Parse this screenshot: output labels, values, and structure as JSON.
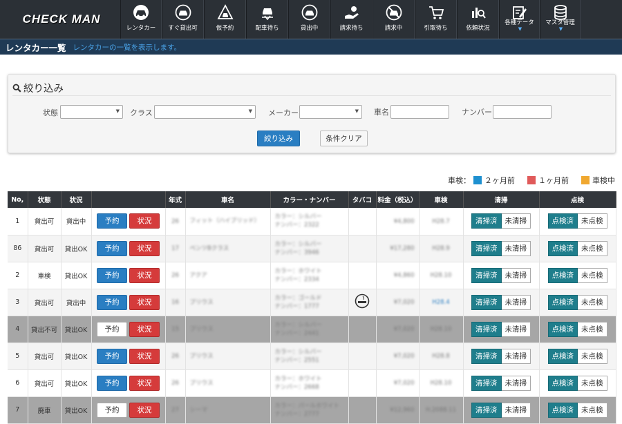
{
  "app": {
    "logo": "CHECK MAN"
  },
  "nav": [
    {
      "label": "レンタカー",
      "icon": "car-icon"
    },
    {
      "label": "すぐ貸出可",
      "icon": "car-circle-icon"
    },
    {
      "label": "仮予約",
      "icon": "warning-car-icon"
    },
    {
      "label": "配車待ち",
      "icon": "dispatch-car-icon"
    },
    {
      "label": "貸出中",
      "icon": "car-circle-icon"
    },
    {
      "label": "請求待ち",
      "icon": "hand-coin-icon"
    },
    {
      "label": "請求中",
      "icon": "no-car-icon"
    },
    {
      "label": "引取待ち",
      "icon": "tow-cart-icon"
    },
    {
      "label": "依頼状況",
      "icon": "chart-search-icon"
    },
    {
      "label": "各種データ",
      "icon": "edit-note-icon",
      "dropdown": true
    },
    {
      "label": "マスタ管理",
      "icon": "database-icon",
      "dropdown": true
    }
  ],
  "page": {
    "title": "レンタカー一覧",
    "description": "レンタカーの一覧を表示します。"
  },
  "filter": {
    "title": "絞り込み",
    "labels": {
      "status": "状態",
      "class": "クラス",
      "maker": "メーカー",
      "car_name": "車名",
      "number": "ナンバー"
    },
    "submit": "絞り込み",
    "clear": "条件クリア"
  },
  "legend": {
    "title": "車検：",
    "items": [
      {
        "label": "２ヶ月前",
        "color": "#1e90d0"
      },
      {
        "label": "１ヶ月前",
        "color": "#e05a5a"
      },
      {
        "label": "車検中",
        "color": "#f0a830"
      }
    ]
  },
  "table": {
    "headers": [
      "No,",
      "状態",
      "状況",
      "",
      "年式",
      "車名",
      "カラー・ナンバー",
      "タバコ",
      "料金（税込）",
      "車検",
      "清掃",
      "点検"
    ],
    "buttons": {
      "reserve": "予約",
      "status": "状況",
      "cleaned": "清掃済",
      "not_cleaned": "未清掃",
      "inspected": "点検済",
      "not_inspected": "未点検"
    },
    "rows": [
      {
        "no": "1",
        "state": "貸出可",
        "situation": "貸出中",
        "year": "26",
        "name": "フィット（ハイブリッド）",
        "color": "カラー：シルバー",
        "plate": "ナンバー：2322",
        "tobacco": false,
        "price": "¥4,800",
        "inspection": "H28.7",
        "dark": false,
        "reserve_active": true
      },
      {
        "no": "86",
        "state": "貸出可",
        "situation": "貸出OK",
        "year": "17",
        "name": "ベンツBクラス",
        "color": "カラー：シルバー",
        "plate": "ナンバー：3946",
        "tobacco": false,
        "price": "¥17,280",
        "inspection": "H28.9",
        "dark": false,
        "reserve_active": true
      },
      {
        "no": "2",
        "state": "車検",
        "situation": "貸出OK",
        "year": "26",
        "name": "アクア",
        "color": "カラー：ホワイト",
        "plate": "ナンバー：2334",
        "tobacco": false,
        "price": "¥4,860",
        "inspection": "H28.10",
        "dark": false,
        "reserve_active": true
      },
      {
        "no": "3",
        "state": "貸出可",
        "situation": "貸出中",
        "year": "16",
        "name": "プリウス",
        "color": "カラー：ゴールド",
        "plate": "ナンバー：1777",
        "tobacco": true,
        "price": "¥7,020",
        "inspection": "H28.4",
        "dark": false,
        "reserve_active": true,
        "link": true
      },
      {
        "no": "4",
        "state": "貸出不可",
        "situation": "貸出OK",
        "year": "15",
        "name": "プリウス",
        "color": "カラー：シルバー",
        "plate": "ナンバー：2441",
        "tobacco": false,
        "price": "¥7,020",
        "inspection": "H28.10",
        "dark": true,
        "reserve_active": false
      },
      {
        "no": "5",
        "state": "貸出可",
        "situation": "貸出OK",
        "year": "26",
        "name": "プリウス",
        "color": "カラー：シルバー",
        "plate": "ナンバー：2551",
        "tobacco": false,
        "price": "¥7,020",
        "inspection": "H28.8",
        "dark": false,
        "reserve_active": true
      },
      {
        "no": "6",
        "state": "貸出可",
        "situation": "貸出OK",
        "year": "26",
        "name": "プリウス",
        "color": "カラー：ホワイト",
        "plate": "ナンバー：2668",
        "tobacco": false,
        "price": "¥7,020",
        "inspection": "H28.10",
        "dark": false,
        "reserve_active": true
      },
      {
        "no": "7",
        "state": "廃車",
        "situation": "貸出OK",
        "year": "27",
        "name": "シーマ",
        "color": "カラー：パールホワイト",
        "plate": "ナンバー：2777",
        "tobacco": false,
        "price": "¥12,960",
        "inspection": "H.2088.11",
        "dark": true,
        "reserve_active": false
      }
    ]
  }
}
